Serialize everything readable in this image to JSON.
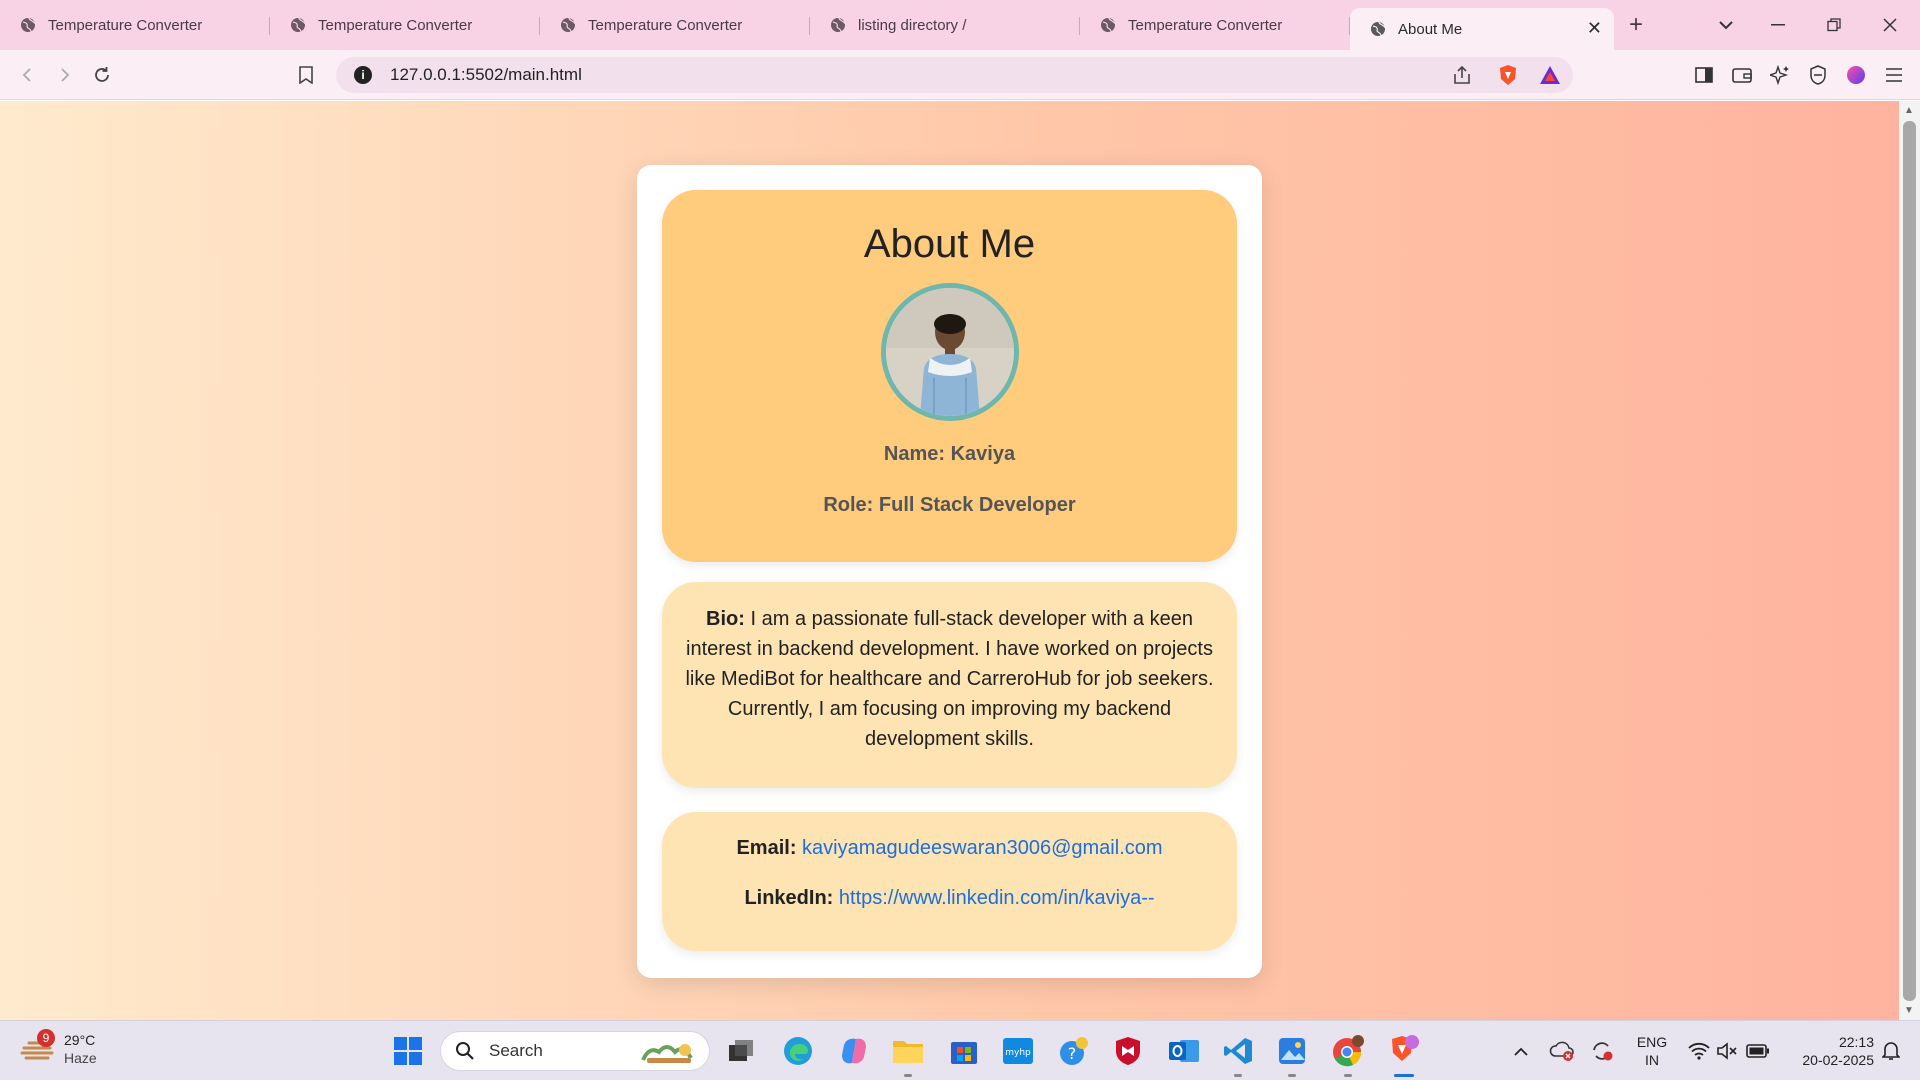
{
  "browser": {
    "tabs": [
      {
        "title": "Temperature Converter"
      },
      {
        "title": "Temperature Converter"
      },
      {
        "title": "Temperature Converter"
      },
      {
        "title": "listing directory /"
      },
      {
        "title": "Temperature Converter"
      },
      {
        "title": "About Me",
        "active": true
      }
    ],
    "url": "127.0.0.1:5502/main.html"
  },
  "page": {
    "heading": "About Me",
    "name": "Name: Kaviya",
    "role": "Role: Full Stack Developer",
    "bio_label": "Bio:",
    "bio_text": "I am a passionate full-stack developer with a keen interest in backend development. I have worked on projects like MediBot for healthcare and CarreroHub for job seekers. Currently, I am focusing on improving my backend development skills.",
    "email_label": "Email:",
    "email": "kaviyamagudeeswaran3006@gmail.com",
    "linkedin_label": "LinkedIn:",
    "linkedin": "https://www.linkedin.com/in/kaviya--"
  },
  "taskbar": {
    "weather_badge": "9",
    "temperature": "29°C",
    "condition": "Haze",
    "search_placeholder": "Search",
    "lang_top": "ENG",
    "lang_bottom": "IN",
    "time": "22:13",
    "date": "20-02-2025"
  },
  "colors": {
    "profile_bg": "#ffcb7d",
    "card_bg": "#ffe4b3",
    "link": "#1a6ee0",
    "avatar_border": "#6fb6ad"
  }
}
